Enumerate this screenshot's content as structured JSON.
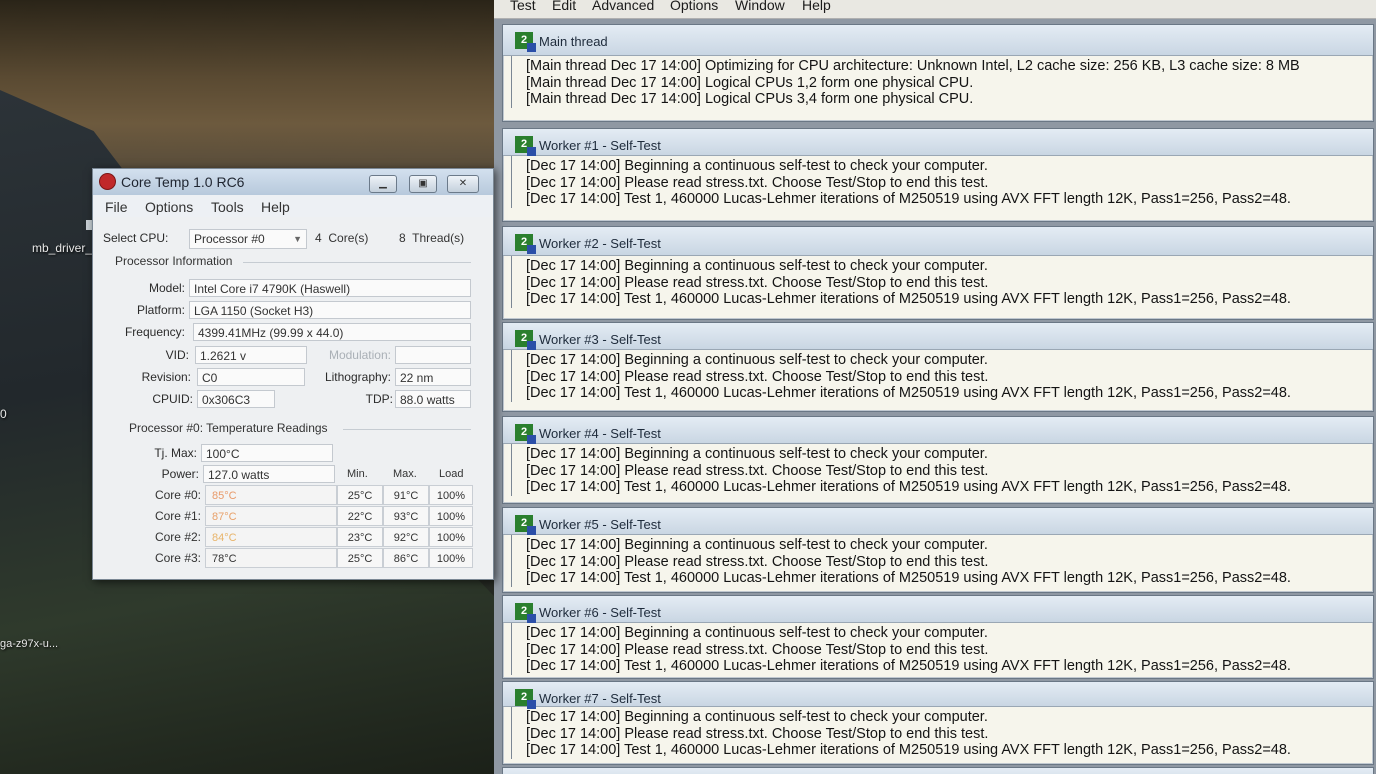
{
  "desktop": {
    "icons": [
      {
        "label": "mb_driver_"
      },
      {
        "label": "0"
      },
      {
        "label": "ga-z97x-u..."
      }
    ]
  },
  "prime95": {
    "menu": [
      "Test",
      "Edit",
      "Advanced",
      "Options",
      "Window",
      "Help"
    ],
    "windows": [
      {
        "title": "Main thread",
        "lines": [
          "[Main thread Dec 17 14:00] Optimizing for CPU architecture: Unknown Intel, L2 cache size: 256 KB, L3 cache size: 8 MB",
          "[Main thread Dec 17 14:00] Logical CPUs 1,2 form one physical CPU.",
          "[Main thread Dec 17 14:00] Logical CPUs 3,4 form one physical CPU."
        ]
      },
      {
        "title": "Worker #1 - Self-Test",
        "lines": [
          "[Dec 17 14:00] Beginning a continuous self-test to check your computer.",
          "[Dec 17 14:00] Please read stress.txt.  Choose Test/Stop to end this test.",
          "[Dec 17 14:00] Test 1, 460000 Lucas-Lehmer iterations of M250519 using AVX FFT length 12K, Pass1=256, Pass2=48."
        ]
      },
      {
        "title": "Worker #2 - Self-Test",
        "lines": [
          "[Dec 17 14:00] Beginning a continuous self-test to check your computer.",
          "[Dec 17 14:00] Please read stress.txt.  Choose Test/Stop to end this test.",
          "[Dec 17 14:00] Test 1, 460000 Lucas-Lehmer iterations of M250519 using AVX FFT length 12K, Pass1=256, Pass2=48."
        ]
      },
      {
        "title": "Worker #3 - Self-Test",
        "lines": [
          "[Dec 17 14:00] Beginning a continuous self-test to check your computer.",
          "[Dec 17 14:00] Please read stress.txt.  Choose Test/Stop to end this test.",
          "[Dec 17 14:00] Test 1, 460000 Lucas-Lehmer iterations of M250519 using AVX FFT length 12K, Pass1=256, Pass2=48."
        ]
      },
      {
        "title": "Worker #4 - Self-Test",
        "lines": [
          "[Dec 17 14:00] Beginning a continuous self-test to check your computer.",
          "[Dec 17 14:00] Please read stress.txt.  Choose Test/Stop to end this test.",
          "[Dec 17 14:00] Test 1, 460000 Lucas-Lehmer iterations of M250519 using AVX FFT length 12K, Pass1=256, Pass2=48."
        ]
      },
      {
        "title": "Worker #5 - Self-Test",
        "lines": [
          "[Dec 17 14:00] Beginning a continuous self-test to check your computer.",
          "[Dec 17 14:00] Please read stress.txt.  Choose Test/Stop to end this test.",
          "[Dec 17 14:00] Test 1, 460000 Lucas-Lehmer iterations of M250519 using AVX FFT length 12K, Pass1=256, Pass2=48."
        ]
      },
      {
        "title": "Worker #6 - Self-Test",
        "lines": [
          "[Dec 17 14:00] Beginning a continuous self-test to check your computer.",
          "[Dec 17 14:00] Please read stress.txt.  Choose Test/Stop to end this test.",
          "[Dec 17 14:00] Test 1, 460000 Lucas-Lehmer iterations of M250519 using AVX FFT length 12K, Pass1=256, Pass2=48."
        ]
      },
      {
        "title": "Worker #7 - Self-Test",
        "lines": [
          "[Dec 17 14:00] Beginning a continuous self-test to check your computer.",
          "[Dec 17 14:00] Please read stress.txt.  Choose Test/Stop to end this test.",
          "[Dec 17 14:00] Test 1, 460000 Lucas-Lehmer iterations of M250519 using AVX FFT length 12K, Pass1=256, Pass2=48."
        ]
      }
    ]
  },
  "coretemp": {
    "title": "Core Temp 1.0 RC6",
    "menu": [
      "File",
      "Options",
      "Tools",
      "Help"
    ],
    "select_cpu_label": "Select CPU:",
    "select_cpu_value": "Processor #0",
    "cores_count": "4",
    "cores_label": "Core(s)",
    "threads_count": "8",
    "threads_label": "Thread(s)",
    "proc_info_label": "Processor Information",
    "model_label": "Model:",
    "model": "Intel Core i7 4790K (Haswell)",
    "platform_label": "Platform:",
    "platform": "LGA 1150 (Socket H3)",
    "frequency_label": "Frequency:",
    "frequency": "4399.41MHz (99.99 x 44.0)",
    "vid_label": "VID:",
    "vid": "1.2621 v",
    "modulation_label": "Modulation:",
    "modulation": "",
    "revision_label": "Revision:",
    "revision": "C0",
    "lithography_label": "Lithography:",
    "lithography": "22 nm",
    "cpuid_label": "CPUID:",
    "cpuid": "0x306C3",
    "tdp_label": "TDP:",
    "tdp": "88.0 watts",
    "temp_section_label": "Processor #0: Temperature Readings",
    "tjmax_label": "Tj. Max:",
    "tjmax": "100°C",
    "power_label": "Power:",
    "power": "127.0 watts",
    "col_min": "Min.",
    "col_max": "Max.",
    "col_load": "Load",
    "cores": [
      {
        "name": "Core #0:",
        "temp": "85°C",
        "min": "25°C",
        "max": "91°C",
        "load": "100%",
        "color": "#e89a6a"
      },
      {
        "name": "Core #1:",
        "temp": "87°C",
        "min": "22°C",
        "max": "93°C",
        "load": "100%",
        "color": "#e8a16a"
      },
      {
        "name": "Core #2:",
        "temp": "84°C",
        "min": "23°C",
        "max": "92°C",
        "load": "100%",
        "color": "#e8b46a"
      },
      {
        "name": "Core #3:",
        "temp": "78°C",
        "min": "25°C",
        "max": "86°C",
        "load": "100%",
        "color": "#333333"
      }
    ]
  }
}
